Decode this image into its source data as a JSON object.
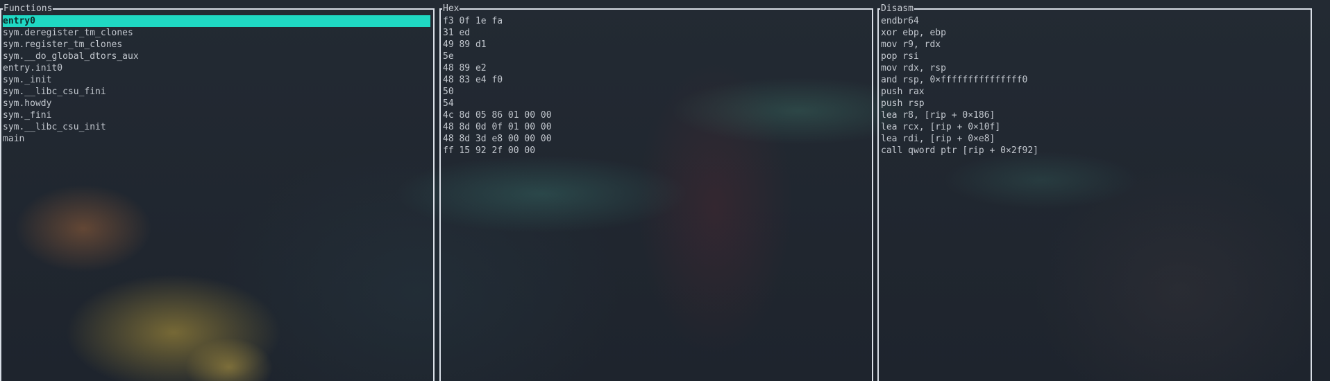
{
  "panels": {
    "functions": {
      "title": "Functions",
      "items": [
        "entry0",
        "sym.deregister_tm_clones",
        "sym.register_tm_clones",
        "sym.__do_global_dtors_aux",
        "entry.init0",
        "sym._init",
        "sym.__libc_csu_fini",
        "sym.howdy",
        "sym._fini",
        "sym.__libc_csu_init",
        "main"
      ],
      "selected_index": 0
    },
    "hex": {
      "title": "Hex",
      "lines": [
        "f3 0f 1e fa",
        "31 ed",
        "49 89 d1",
        "5e",
        "48 89 e2",
        "48 83 e4 f0",
        "50",
        "54",
        "4c 8d 05 86 01 00 00",
        "48 8d 0d 0f 01 00 00",
        "48 8d 3d e8 00 00 00",
        "ff 15 92 2f 00 00"
      ]
    },
    "disasm": {
      "title": "Disasm",
      "lines": [
        "endbr64",
        "xor ebp, ebp",
        "mov r9, rdx",
        "pop rsi",
        "mov rdx, rsp",
        "and rsp, 0×fffffffffffffff0",
        "push rax",
        "push rsp",
        "lea r8, [rip + 0×186]",
        "lea rcx, [rip + 0×10f]",
        "lea rdi, [rip + 0×e8]",
        "call qword ptr [rip + 0×2f92]"
      ]
    }
  },
  "colors": {
    "selection": "#1fd8c3",
    "border": "#d9dee6",
    "text": "#c3c8cf"
  }
}
